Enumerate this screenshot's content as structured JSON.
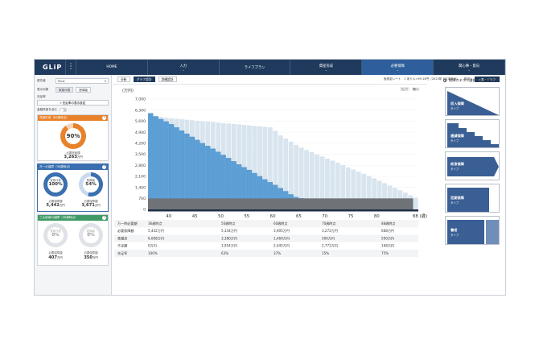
{
  "app": {
    "logo": "GLiP",
    "menu_icon": "kebab-icon"
  },
  "nav": [
    {
      "label": "HOME",
      "chevron": false,
      "active": false
    },
    {
      "label": "入力",
      "chevron": true,
      "active": false
    },
    {
      "label": "ライフプラン",
      "chevron": false,
      "active": false
    },
    {
      "label": "資産形成",
      "chevron": true,
      "active": false
    },
    {
      "label": "必要保障",
      "chevron": true,
      "active": true
    },
    {
      "label": "関心事・意向",
      "chevron": true,
      "active": false
    }
  ],
  "sidebar": {
    "priority_label": "優先度",
    "priority_value": "Must",
    "display_target_label": "表示対象",
    "target_household": "家族代表",
    "target_spouse": "配偶者",
    "fulfillment_label": "充足率",
    "fulfillment_button": "充足率の表示設定",
    "include_finance_label": "金融資産を含む",
    "card1": {
      "title": "資産形成（65歳時点）",
      "percent": "90%",
      "caption": "必要資産額",
      "amount": "3,263",
      "unit": "万円",
      "color": "#e8822a",
      "fill": 0.9
    },
    "card2": {
      "title": "万一の保障（36歳時点）",
      "left_label": "家族代表",
      "left_percent": "100%",
      "left_fill": 1.0,
      "right_label": "配偶者",
      "right_percent": "54%",
      "right_fill": 0.54,
      "caption": "必要保障額",
      "left_amount": "5,442",
      "right_amount": "3,671",
      "unit": "万円",
      "color": "#3a6fb0"
    },
    "card3": {
      "title": "三大疾病の保障（36歳時点）",
      "left_label": "家族代表",
      "left_percent": "0%",
      "right_label": "配偶者",
      "right_percent": "0%",
      "caption": "必要保障額",
      "left_amount": "407",
      "right_amount": "350",
      "unit": "万円",
      "color": "#3f9a66"
    }
  },
  "toolbar": {
    "tab1": "分析",
    "tab2": "グラフ設計",
    "tab3": "詳細設計",
    "rate_label": "仮設定レート　1 米ドル=99.14円（2023年 6月末時点）",
    "settings": "設定",
    "view_toggle": "表・グラフ"
  },
  "zoom": {
    "in": "拡大",
    "out": "縮小"
  },
  "chart_data": {
    "type": "area",
    "ylabel": "(万円)",
    "y_ticks": [
      0,
      700,
      1400,
      2100,
      2800,
      3500,
      4200,
      4900,
      5600,
      6300,
      7000
    ],
    "ylim": [
      0,
      7000
    ],
    "x_ticks": [
      "40",
      "45",
      "50",
      "55",
      "60",
      "65",
      "70",
      "75",
      "80",
      "88 (歳)"
    ],
    "x_range": [
      36,
      88
    ],
    "series": [
      {
        "name": "必要保障額",
        "color": "#5b9fd6",
        "points": [
          [
            36,
            6200
          ],
          [
            37,
            6000
          ],
          [
            38,
            5800
          ],
          [
            39,
            5650
          ],
          [
            40,
            5500
          ],
          [
            41,
            5300
          ],
          [
            42,
            5100
          ],
          [
            43,
            4900
          ],
          [
            44,
            4700
          ],
          [
            45,
            4500
          ],
          [
            46,
            4300
          ],
          [
            47,
            4100
          ],
          [
            48,
            3950
          ],
          [
            49,
            3750
          ],
          [
            50,
            3550
          ],
          [
            51,
            3350
          ],
          [
            52,
            3150
          ],
          [
            53,
            2950
          ],
          [
            54,
            2750
          ],
          [
            55,
            2600
          ],
          [
            56,
            2400
          ],
          [
            57,
            2200
          ],
          [
            58,
            2000
          ],
          [
            59,
            1800
          ],
          [
            60,
            1650
          ],
          [
            61,
            1450
          ],
          [
            62,
            1250
          ],
          [
            63,
            1050
          ],
          [
            64,
            850
          ],
          [
            65,
            700
          ]
        ]
      },
      {
        "name": "準備済",
        "color": "#d8e4ee",
        "points": [
          [
            36,
            6000
          ],
          [
            40,
            5800
          ],
          [
            45,
            5650
          ],
          [
            50,
            5500
          ],
          [
            55,
            5350
          ],
          [
            60,
            5200
          ],
          [
            61,
            4800
          ],
          [
            62,
            4600
          ],
          [
            63,
            4400
          ],
          [
            64,
            4200
          ],
          [
            65,
            4000
          ],
          [
            67,
            3700
          ],
          [
            70,
            3300
          ],
          [
            73,
            2900
          ],
          [
            75,
            2600
          ],
          [
            78,
            2200
          ],
          [
            80,
            1900
          ],
          [
            82,
            1600
          ],
          [
            84,
            1300
          ],
          [
            86,
            1000
          ],
          [
            87,
            800
          ],
          [
            88,
            700
          ]
        ]
      }
    ],
    "base_band": 700
  },
  "table": {
    "columns": [
      "",
      "36歳時点",
      "50歳時点",
      "60歳時点",
      "70歳時点",
      "88歳時点"
    ],
    "rows": [
      [
        "万一時必要額",
        "36歳時点",
        "50歳時点",
        "60歳時点",
        "70歳時点",
        "88歳時点"
      ],
      [
        "必要保障額",
        "5,442万円",
        "5,334万円",
        "3,905万円",
        "3,272万円",
        "668万円"
      ],
      [
        "準備済",
        "6,068万円",
        "3,380万円",
        "1,460万円",
        "500万円",
        "500万円"
      ],
      [
        "不足額",
        "0万円",
        "1,954万円",
        "2,445万円",
        "2,772万円",
        "168万円"
      ],
      [
        "充足率",
        "100%",
        "63%",
        "37%",
        "15%",
        "75%"
      ]
    ]
  },
  "right_panel": {
    "title": "保障カテゴリ選択",
    "option2": "凡例",
    "cats": [
      {
        "label": "収入保障",
        "sub": "タイプ"
      },
      {
        "label": "逓減保障",
        "sub": "タイプ"
      },
      {
        "label": "終身保障",
        "sub": "タイプ"
      },
      {
        "label": "定期保障",
        "sub": "タイプ"
      },
      {
        "label": "養老",
        "sub": "タイプ"
      }
    ]
  }
}
